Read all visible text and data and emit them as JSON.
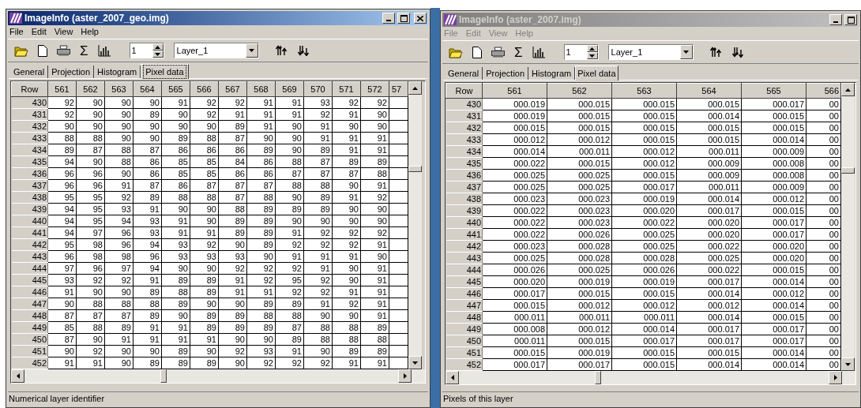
{
  "windows": [
    {
      "title": "ImageInfo (aster_2007_geo.img)",
      "active": true,
      "menu": [
        "File",
        "Edit",
        "View",
        "Help"
      ],
      "sum_button": "Σ",
      "layer_number": "1",
      "layer": "Layer_1",
      "tabs": [
        {
          "label": "General",
          "selected": false
        },
        {
          "label": "Projection",
          "selected": false
        },
        {
          "label": "Histogram",
          "selected": false
        },
        {
          "label": "Pixel data",
          "selected": true
        }
      ],
      "table": {
        "row_header": "Row",
        "columns": [
          "561",
          "562",
          "563",
          "564",
          "565",
          "566",
          "567",
          "568",
          "569",
          "570",
          "571",
          "572",
          "57"
        ],
        "rows": [
          {
            "row": "430",
            "cells": [
              "92",
              "90",
              "90",
              "90",
              "91",
              "92",
              "92",
              "91",
              "91",
              "93",
              "92",
              "92"
            ]
          },
          {
            "row": "431",
            "cells": [
              "92",
              "90",
              "90",
              "89",
              "90",
              "92",
              "91",
              "91",
              "91",
              "92",
              "91",
              "90"
            ]
          },
          {
            "row": "432",
            "cells": [
              "90",
              "90",
              "90",
              "90",
              "90",
              "90",
              "89",
              "91",
              "90",
              "91",
              "90",
              "90"
            ]
          },
          {
            "row": "433",
            "cells": [
              "88",
              "88",
              "90",
              "90",
              "89",
              "88",
              "87",
              "90",
              "90",
              "91",
              "91",
              "91"
            ]
          },
          {
            "row": "434",
            "cells": [
              "89",
              "87",
              "88",
              "87",
              "86",
              "86",
              "86",
              "89",
              "90",
              "89",
              "91",
              "91"
            ]
          },
          {
            "row": "435",
            "cells": [
              "94",
              "90",
              "88",
              "86",
              "85",
              "85",
              "84",
              "86",
              "88",
              "87",
              "89",
              "89"
            ]
          },
          {
            "row": "436",
            "cells": [
              "96",
              "96",
              "90",
              "86",
              "85",
              "85",
              "86",
              "86",
              "87",
              "87",
              "87",
              "88"
            ]
          },
          {
            "row": "437",
            "cells": [
              "96",
              "96",
              "91",
              "87",
              "86",
              "87",
              "87",
              "87",
              "88",
              "88",
              "90",
              "91"
            ]
          },
          {
            "row": "438",
            "cells": [
              "95",
              "95",
              "92",
              "89",
              "88",
              "88",
              "87",
              "88",
              "90",
              "89",
              "91",
              "92"
            ]
          },
          {
            "row": "439",
            "cells": [
              "94",
              "95",
              "93",
              "91",
              "90",
              "90",
              "88",
              "89",
              "89",
              "89",
              "90",
              "90"
            ]
          },
          {
            "row": "440",
            "cells": [
              "94",
              "95",
              "94",
              "93",
              "91",
              "90",
              "89",
              "89",
              "90",
              "90",
              "90",
              "90"
            ]
          },
          {
            "row": "441",
            "cells": [
              "94",
              "97",
              "96",
              "93",
              "91",
              "91",
              "89",
              "89",
              "91",
              "92",
              "92",
              "92"
            ]
          },
          {
            "row": "442",
            "cells": [
              "95",
              "98",
              "96",
              "94",
              "93",
              "92",
              "90",
              "89",
              "92",
              "92",
              "92",
              "91"
            ]
          },
          {
            "row": "443",
            "cells": [
              "96",
              "98",
              "98",
              "96",
              "93",
              "93",
              "93",
              "90",
              "91",
              "91",
              "91",
              "90"
            ]
          },
          {
            "row": "444",
            "cells": [
              "97",
              "96",
              "97",
              "94",
              "90",
              "90",
              "92",
              "92",
              "92",
              "91",
              "90",
              "91"
            ]
          },
          {
            "row": "445",
            "cells": [
              "93",
              "92",
              "92",
              "91",
              "89",
              "89",
              "91",
              "92",
              "95",
              "92",
              "90",
              "91"
            ]
          },
          {
            "row": "446",
            "cells": [
              "91",
              "90",
              "90",
              "89",
              "88",
              "89",
              "91",
              "91",
              "92",
              "92",
              "91",
              "91"
            ]
          },
          {
            "row": "447",
            "cells": [
              "90",
              "88",
              "88",
              "88",
              "89",
              "90",
              "90",
              "89",
              "89",
              "91",
              "92",
              "91"
            ]
          },
          {
            "row": "448",
            "cells": [
              "87",
              "87",
              "87",
              "89",
              "90",
              "89",
              "89",
              "88",
              "88",
              "90",
              "90",
              "91"
            ]
          },
          {
            "row": "449",
            "cells": [
              "85",
              "88",
              "89",
              "91",
              "91",
              "89",
              "89",
              "89",
              "87",
              "88",
              "88",
              "89"
            ]
          },
          {
            "row": "450",
            "cells": [
              "87",
              "90",
              "91",
              "91",
              "91",
              "91",
              "90",
              "90",
              "89",
              "88",
              "88",
              "88"
            ]
          },
          {
            "row": "451",
            "cells": [
              "90",
              "92",
              "90",
              "90",
              "89",
              "90",
              "92",
              "93",
              "91",
              "90",
              "89",
              "89"
            ]
          },
          {
            "row": "452",
            "cells": [
              "91",
              "91",
              "90",
              "89",
              "89",
              "89",
              "90",
              "92",
              "92",
              "92",
              "91",
              "91"
            ]
          }
        ]
      },
      "status": "Numerical layer identifier"
    },
    {
      "title": "ImageInfo (aster_2007.img)",
      "active": false,
      "menu": [
        "File",
        "Edit",
        "View",
        "Help"
      ],
      "sum_button": "Σ",
      "layer_number": "1",
      "layer": "Layer_1",
      "tabs": [
        {
          "label": "General",
          "selected": false
        },
        {
          "label": "Projection",
          "selected": false
        },
        {
          "label": "Histogram",
          "selected": false
        },
        {
          "label": "Pixel data",
          "selected": true
        }
      ],
      "table": {
        "row_header": "Row",
        "columns": [
          "561",
          "562",
          "563",
          "564",
          "565",
          "566"
        ],
        "rows": [
          {
            "row": "430",
            "cells": [
              "000.019",
              "000.015",
              "000.015",
              "000.015",
              "000.017",
              "00"
            ]
          },
          {
            "row": "431",
            "cells": [
              "000.019",
              "000.015",
              "000.015",
              "000.014",
              "000.015",
              "00"
            ]
          },
          {
            "row": "432",
            "cells": [
              "000.015",
              "000.015",
              "000.015",
              "000.015",
              "000.015",
              "00"
            ]
          },
          {
            "row": "433",
            "cells": [
              "000.012",
              "000.012",
              "000.015",
              "000.015",
              "000.014",
              "00"
            ]
          },
          {
            "row": "434",
            "cells": [
              "000.014",
              "000.011",
              "000.012",
              "000.011",
              "000.009",
              "00"
            ]
          },
          {
            "row": "435",
            "cells": [
              "000.022",
              "000.015",
              "000.012",
              "000.009",
              "000.008",
              "00"
            ]
          },
          {
            "row": "436",
            "cells": [
              "000.025",
              "000.025",
              "000.015",
              "000.009",
              "000.008",
              "00"
            ]
          },
          {
            "row": "437",
            "cells": [
              "000.025",
              "000.025",
              "000.017",
              "000.011",
              "000.009",
              "00"
            ]
          },
          {
            "row": "438",
            "cells": [
              "000.023",
              "000.023",
              "000.019",
              "000.014",
              "000.012",
              "00"
            ]
          },
          {
            "row": "439",
            "cells": [
              "000.022",
              "000.023",
              "000.020",
              "000.017",
              "000.015",
              "00"
            ]
          },
          {
            "row": "440",
            "cells": [
              "000.022",
              "000.023",
              "000.022",
              "000.020",
              "000.017",
              "00"
            ]
          },
          {
            "row": "441",
            "cells": [
              "000.022",
              "000.026",
              "000.025",
              "000.020",
              "000.017",
              "00"
            ]
          },
          {
            "row": "442",
            "cells": [
              "000.023",
              "000.028",
              "000.025",
              "000.022",
              "000.020",
              "00"
            ]
          },
          {
            "row": "443",
            "cells": [
              "000.025",
              "000.028",
              "000.028",
              "000.025",
              "000.020",
              "00"
            ]
          },
          {
            "row": "444",
            "cells": [
              "000.026",
              "000.025",
              "000.026",
              "000.022",
              "000.015",
              "00"
            ]
          },
          {
            "row": "445",
            "cells": [
              "000.020",
              "000.019",
              "000.019",
              "000.017",
              "000.014",
              "00"
            ]
          },
          {
            "row": "446",
            "cells": [
              "000.017",
              "000.015",
              "000.015",
              "000.014",
              "000.012",
              "00"
            ]
          },
          {
            "row": "447",
            "cells": [
              "000.015",
              "000.012",
              "000.012",
              "000.012",
              "000.014",
              "00"
            ]
          },
          {
            "row": "448",
            "cells": [
              "000.011",
              "000.011",
              "000.011",
              "000.014",
              "000.015",
              "00"
            ]
          },
          {
            "row": "449",
            "cells": [
              "000.008",
              "000.012",
              "000.014",
              "000.017",
              "000.017",
              "00"
            ]
          },
          {
            "row": "450",
            "cells": [
              "000.011",
              "000.015",
              "000.017",
              "000.017",
              "000.017",
              "00"
            ]
          },
          {
            "row": "451",
            "cells": [
              "000.015",
              "000.019",
              "000.015",
              "000.015",
              "000.014",
              "00"
            ]
          },
          {
            "row": "452",
            "cells": [
              "000.017",
              "000.017",
              "000.015",
              "000.014",
              "000.014",
              "00"
            ]
          }
        ]
      },
      "status": "Pixels of this layer"
    }
  ]
}
